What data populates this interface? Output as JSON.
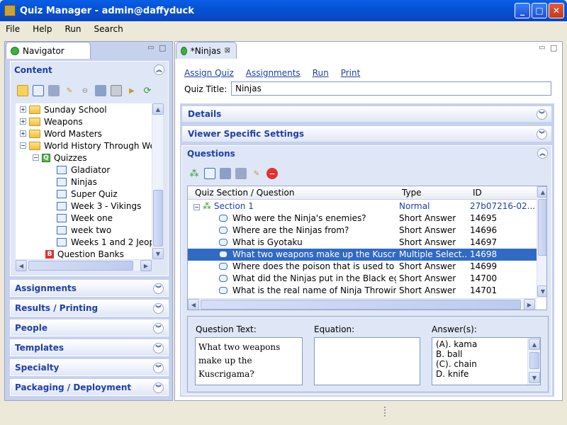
{
  "window": {
    "title": "Quiz Manager - admin@daffyduck",
    "min": "_",
    "max": "□",
    "close": "✕"
  },
  "menu": [
    "File",
    "Help",
    "Run",
    "Search"
  ],
  "navigator": {
    "tab_label": "Navigator",
    "content_title": "Content",
    "tree": [
      {
        "label": "Sunday School",
        "type": "folder"
      },
      {
        "label": "Weapons",
        "type": "folder"
      },
      {
        "label": "Word Masters",
        "type": "folder"
      },
      {
        "label": "World History Through We",
        "type": "folder"
      },
      {
        "label": "Quizzes",
        "type": "quizzes"
      },
      {
        "label": "Gladiator",
        "type": "quiz"
      },
      {
        "label": "Ninjas",
        "type": "quiz"
      },
      {
        "label": "Super Quiz",
        "type": "quiz"
      },
      {
        "label": "Week 3 - Vikings",
        "type": "quiz"
      },
      {
        "label": "Week one",
        "type": "quiz"
      },
      {
        "label": "week two",
        "type": "quiz"
      },
      {
        "label": "Weeks 1 and 2 Jeop",
        "type": "quiz"
      },
      {
        "label": "Question Banks",
        "type": "banks"
      }
    ],
    "sections": [
      "Assignments",
      "Results / Printing",
      "People",
      "Templates",
      "Specialty",
      "Packaging / Deployment"
    ]
  },
  "editor": {
    "tab_label": "*Ninjas",
    "tab_close": "⊠",
    "links": [
      "Assign Quiz",
      "Assignments",
      "Run",
      "Print"
    ],
    "quiz_title_label": "Quiz Title:",
    "quiz_title_value": "Ninjas",
    "sections": {
      "details": "Details",
      "viewer": "Viewer Specific Settings",
      "questions": "Questions"
    },
    "grid": {
      "headers": [
        "Quiz Section / Question",
        "Type",
        "ID"
      ],
      "section_row": {
        "label": "Section 1",
        "type": "Normal",
        "id": "27b07216-02..."
      },
      "rows": [
        {
          "q": "Who were the Ninja's enemies?",
          "type": "Short Answer",
          "id": "14695"
        },
        {
          "q": "Where are the Ninjas from?",
          "type": "Short Answer",
          "id": "14696"
        },
        {
          "q": "What is Gyotaku",
          "type": "Short Answer",
          "id": "14697"
        },
        {
          "q": "What two weapons make up the Kuscriga",
          "type": "Multiple Select...",
          "id": "14698"
        },
        {
          "q": "Where does the poison that is used to ma",
          "type": "Short Answer",
          "id": "14699"
        },
        {
          "q": "What did the Ninjas put in the Black eggs",
          "type": "Short Answer",
          "id": "14700"
        },
        {
          "q": "What is the real name of Ninja Throwing s",
          "type": "Short Answer",
          "id": "14701"
        }
      ],
      "selected_index": 3
    },
    "detail": {
      "question_text_label": "Question Text:",
      "question_text": "What two weapons make up the Kuscrigama?",
      "equation_label": "Equation:",
      "answers_label": "Answer(s):",
      "answers": [
        "(A). kama",
        "B. ball",
        "(C). chain",
        "D. knife"
      ]
    }
  }
}
